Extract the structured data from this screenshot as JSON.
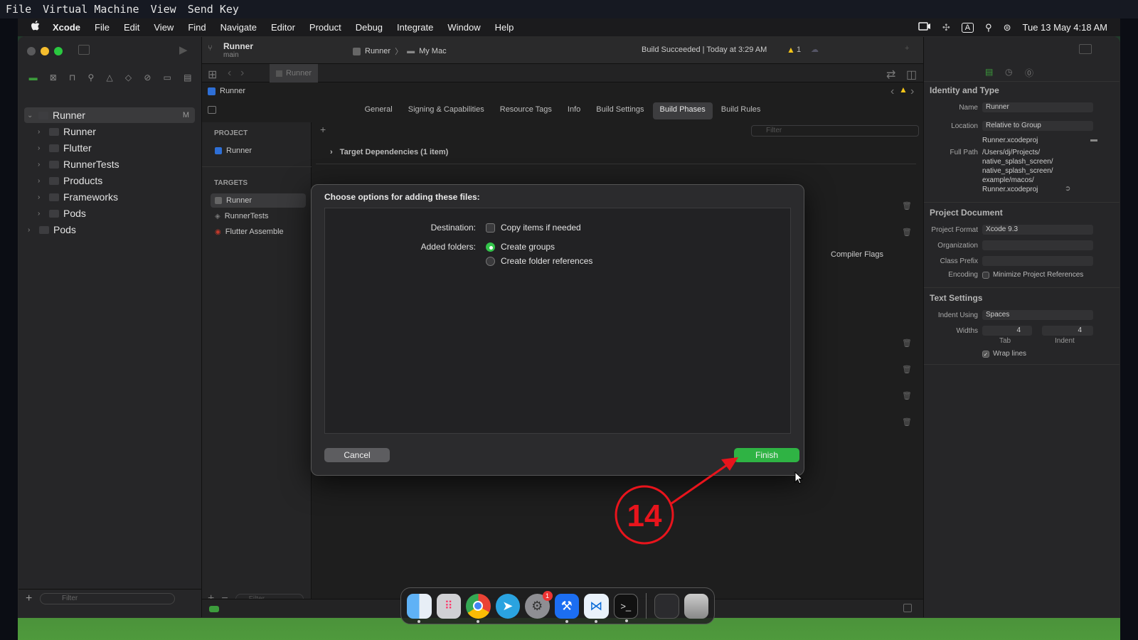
{
  "vm_menu": [
    "File",
    "Virtual Machine",
    "View",
    "Send Key"
  ],
  "menubar": {
    "apple": "",
    "items": [
      "Xcode",
      "File",
      "Edit",
      "View",
      "Find",
      "Navigate",
      "Editor",
      "Product",
      "Debug",
      "Integrate",
      "Window",
      "Help"
    ],
    "input_indicator": "A",
    "clock": "Tue 13 May  4:18 AM"
  },
  "toolbar": {
    "project": "Runner",
    "branch": "main",
    "scheme": "Runner",
    "destination": "My Mac",
    "status": "Build Succeeded | Today at 3:29 AM",
    "warning_count": "1"
  },
  "navigator": {
    "root": "Runner",
    "root_badge": "M",
    "items": [
      "Runner",
      "Flutter",
      "RunnerTests",
      "Products",
      "Frameworks",
      "Pods"
    ],
    "pods": "Pods",
    "filter_placeholder": "Filter"
  },
  "editor": {
    "tab": "Runner",
    "jump_bar": "Runner",
    "settings_tabs": [
      "General",
      "Signing & Capabilities",
      "Resource Tags",
      "Info",
      "Build Settings",
      "Build Phases",
      "Build Rules"
    ],
    "active_tab": "Build Phases",
    "filter_placeholder": "Filter",
    "project_header": "PROJECT",
    "project_item": "Runner",
    "targets_header": "TARGETS",
    "targets": [
      "Runner",
      "RunnerTests",
      "Flutter Assemble"
    ],
    "target_dependencies": "Target Dependencies (1 item)",
    "compiler_flags": "Compiler Flags",
    "targets_filter": "Filter"
  },
  "dialog": {
    "title": "Choose options for adding these files:",
    "destination_label": "Destination:",
    "copy_items": "Copy items if needed",
    "added_folders_label": "Added folders:",
    "create_groups": "Create groups",
    "create_folder_refs": "Create folder references",
    "cancel": "Cancel",
    "finish": "Finish"
  },
  "annotation": {
    "step": "14",
    "color": "#e8141c"
  },
  "inspector": {
    "identity_header": "Identity and Type",
    "name_label": "Name",
    "name_value": "Runner",
    "location_label": "Location",
    "location_value": "Relative to Group",
    "file_name": "Runner.xcodeproj",
    "full_path_label": "Full Path",
    "full_path": [
      "/Users/dj/Projects/",
      "native_splash_screen/",
      "native_splash_screen/",
      "example/macos/",
      "Runner.xcodeproj"
    ],
    "project_doc_header": "Project Document",
    "project_format_label": "Project Format",
    "project_format_value": "Xcode 9.3",
    "organization_label": "Organization",
    "class_prefix_label": "Class Prefix",
    "encoding_label": "Encoding",
    "minimize_refs": "Minimize Project References",
    "text_settings_header": "Text Settings",
    "indent_using_label": "Indent Using",
    "indent_using_value": "Spaces",
    "widths_label": "Widths",
    "tab_width": "4",
    "indent_width": "4",
    "tab_caption": "Tab",
    "indent_caption": "Indent",
    "wrap_lines": "Wrap lines"
  },
  "colors": {
    "accent_green": "#33c44a",
    "finish_button": "#2fb344"
  }
}
